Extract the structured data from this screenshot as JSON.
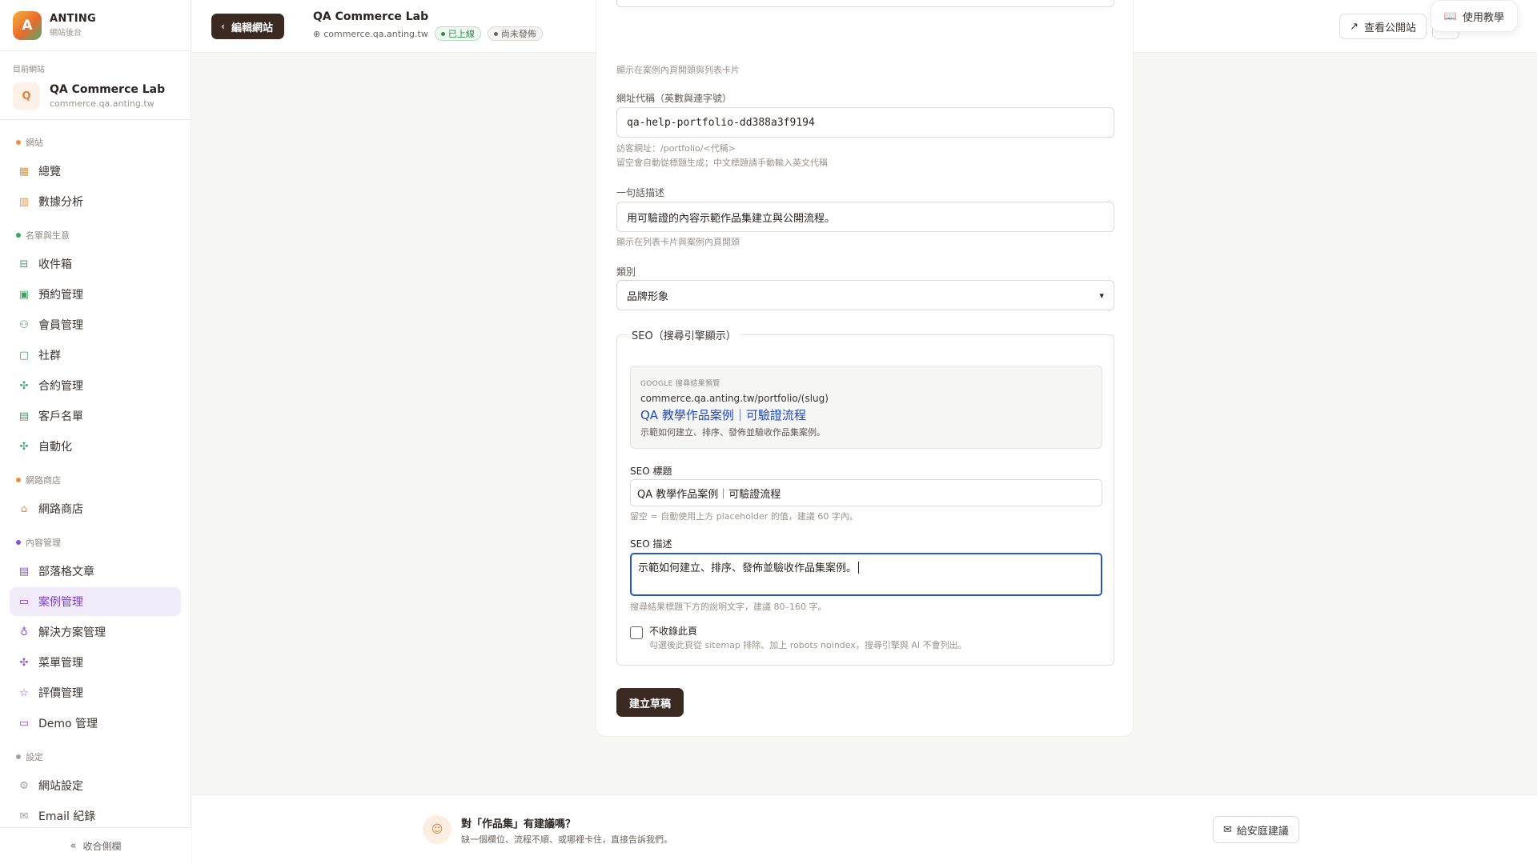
{
  "brand": {
    "logo_letter": "A",
    "name": "ANTING",
    "subtitle": "網站後台"
  },
  "current_site": {
    "label": "目前網站",
    "avatar_letter": "Q",
    "name": "QA Commerce Lab",
    "url": "commerce.qa.anting.tw"
  },
  "nav": {
    "sections": [
      {
        "title": "網站",
        "color": "#e8913a",
        "items": [
          {
            "label": "總覽",
            "icon": "grid-icon"
          },
          {
            "label": "數據分析",
            "icon": "bar-chart-icon"
          }
        ]
      },
      {
        "title": "名單與生意",
        "color": "#3aa661",
        "items": [
          {
            "label": "收件箱",
            "icon": "inbox-icon"
          },
          {
            "label": "預約管理",
            "icon": "calendar-icon"
          },
          {
            "label": "會員管理",
            "icon": "users-icon"
          },
          {
            "label": "社群",
            "icon": "chat-icon"
          },
          {
            "label": "合約管理",
            "icon": "cluster-icon"
          },
          {
            "label": "客戶名單",
            "icon": "contact-icon"
          },
          {
            "label": "自動化",
            "icon": "cluster-icon"
          }
        ]
      },
      {
        "title": "網路商店",
        "color": "#e8913a",
        "items": [
          {
            "label": "網路商店",
            "icon": "store-icon"
          }
        ]
      },
      {
        "title": "內容管理",
        "color": "#8a4fd8",
        "items": [
          {
            "label": "部落格文章",
            "icon": "document-icon"
          },
          {
            "label": "案例管理",
            "icon": "briefcase-icon",
            "active": true
          },
          {
            "label": "解決方案管理",
            "icon": "lightbulb-icon"
          },
          {
            "label": "菜單管理",
            "icon": "cluster-icon"
          },
          {
            "label": "評價管理",
            "icon": "star-icon"
          },
          {
            "label": "Demo 管理",
            "icon": "presentation-icon"
          }
        ]
      },
      {
        "title": "設定",
        "color": "#a6a19c",
        "items": [
          {
            "label": "網站設定",
            "icon": "gear-icon"
          },
          {
            "label": "Email 紀錄",
            "icon": "mail-icon"
          }
        ]
      }
    ],
    "collapse_label": "收合側欄"
  },
  "topbar": {
    "edit_label": "編輯網站",
    "site_name": "QA Commerce Lab",
    "site_url": "commerce.qa.anting.tw",
    "status_online": "已上線",
    "status_draft": "尚未發佈",
    "view_site_label": "查看公開站",
    "tutorial_label": "使用教學"
  },
  "form": {
    "title_help": "顯示在案例內頁開頭與列表卡片",
    "slug_label": "網址代稱（英數與連字號）",
    "slug_value": "qa-help-portfolio-dd388a3f9194",
    "slug_help1": "訪客網址：/portfolio/<代稱>",
    "slug_help2": "留空會自動從標題生成；中文標題請手動輸入英文代稱",
    "summary_label": "一句話描述",
    "summary_value": "用可驗證的內容示範作品集建立與公開流程。",
    "summary_help": "顯示在列表卡片與案例內頁開頭",
    "category_label": "類別",
    "category_value": "品牌形象",
    "seo": {
      "legend": "SEO（搜尋引擎顯示）",
      "preview_label": "GOOGLE 搜尋結果預覽",
      "preview_url": "commerce.qa.anting.tw/portfolio/(slug)",
      "preview_title": "QA 教學作品案例｜可驗證流程",
      "preview_desc": "示範如何建立、排序、發佈並驗收作品集案例。",
      "title_label": "SEO 標題",
      "title_value": "QA 教學作品案例｜可驗證流程",
      "title_help": "留空 = 自動使用上方 placeholder 的值，建議 60 字內。",
      "desc_label": "SEO 描述",
      "desc_value": "示範如何建立、排序、發佈並驗收作品集案例。",
      "desc_help": "搜尋結果標題下方的說明文字，建議 80–160 字。",
      "noindex_label": "不收錄此頁",
      "noindex_help": "勾選後此頁從 sitemap 排除、加上 robots noindex，搜尋引擎與 AI 不會列出。",
      "noindex_checked": false
    },
    "submit_label": "建立草稿"
  },
  "feedback": {
    "title": "對「作品集」有建議嗎？",
    "subtitle": "缺一個欄位、流程不順、或哪裡卡住，直接告訴我們。",
    "button_label": "給安庭建議"
  }
}
